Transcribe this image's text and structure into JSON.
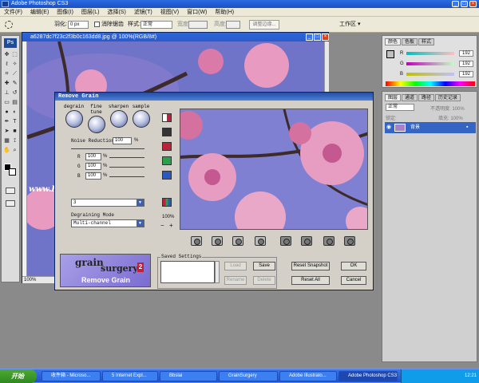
{
  "app": {
    "title": "Adobe Photoshop CS3",
    "ps_logo": "Ps"
  },
  "menu": [
    "文件(F)",
    "编辑(E)",
    "图像(I)",
    "图层(L)",
    "选择(S)",
    "滤镜(T)",
    "视图(V)",
    "窗口(W)",
    "帮助(H)"
  ],
  "options": {
    "feather_label": "羽化:",
    "feather_value": "0 px",
    "antialias_label": "消除锯齿",
    "style_label": "样式:",
    "style_value": "正常",
    "width_label": "宽度:",
    "height_label": "高度:",
    "refine_label": "调整边缘...",
    "workspace_label": "工作区 ▾"
  },
  "document": {
    "title": "a6287dc7f23c2f3b0c163dd8.jpg @ 100%(RGB/8#)",
    "zoom": "100%",
    "watermark": "www.Psjia.com"
  },
  "dialog": {
    "title": "Remove Grain",
    "tabs": [
      {
        "label": "degrain",
        "icon": "degrain-icon"
      },
      {
        "label": "fine tune",
        "icon": "fine-tune-icon"
      },
      {
        "label": "sharpen",
        "icon": "sharpen-icon"
      },
      {
        "label": "sample",
        "icon": "sample-icon"
      }
    ],
    "noise_reduction_label": "Noise Reduction",
    "noise_reduction_value": "100",
    "noise_reduction_unit": "%",
    "channels": [
      {
        "label": "R",
        "value": "100",
        "unit": "%"
      },
      {
        "label": "G",
        "value": "100",
        "unit": "%"
      },
      {
        "label": "B",
        "value": "100",
        "unit": "%"
      }
    ],
    "dropdown1_value": "3",
    "degraining_mode_label": "Degraining Mode",
    "degraining_mode_value": "Multi-channel",
    "zoom_text": "100%",
    "zoom_minus": "−",
    "zoom_plus": "+",
    "logo_line1": "grain",
    "logo_line2": "surgery",
    "logo_num": "2",
    "logo_caption": "Remove Grain",
    "saved_settings_label": "Saved Settings",
    "buttons": {
      "load": "Load",
      "save": "Save",
      "rename": "Rename",
      "delete": "Delete",
      "reset_snapshot": "Reset Snapshot",
      "reset_all": "Reset All",
      "ok": "OK",
      "cancel": "Cancel"
    }
  },
  "color_panel": {
    "tabs": [
      "颜色",
      "色板",
      "样式"
    ],
    "rows": [
      {
        "label": "R",
        "value": "192"
      },
      {
        "label": "G",
        "value": "192"
      },
      {
        "label": "B",
        "value": "192"
      }
    ]
  },
  "layers_panel": {
    "tabs": [
      "图层",
      "通道",
      "路径",
      "历史记录"
    ],
    "blend": "正常",
    "opacity": "不透明度: 100%",
    "lock_label": "锁定:",
    "fill": "填充: 100%",
    "layer_name": "背景"
  },
  "taskbar": {
    "start": "开始",
    "items": [
      "收件箱 - Microso...",
      "5 Internet Expl...",
      "Bbslai",
      "GrainSurgery",
      "Adobe Illustrato...",
      "Adobe Photoshop CS3"
    ],
    "clock": "12:21"
  },
  "colors": {
    "photo_sky": "#6f74c8",
    "blossom": "#e89ac0",
    "accent_blue": "#3465c4"
  }
}
